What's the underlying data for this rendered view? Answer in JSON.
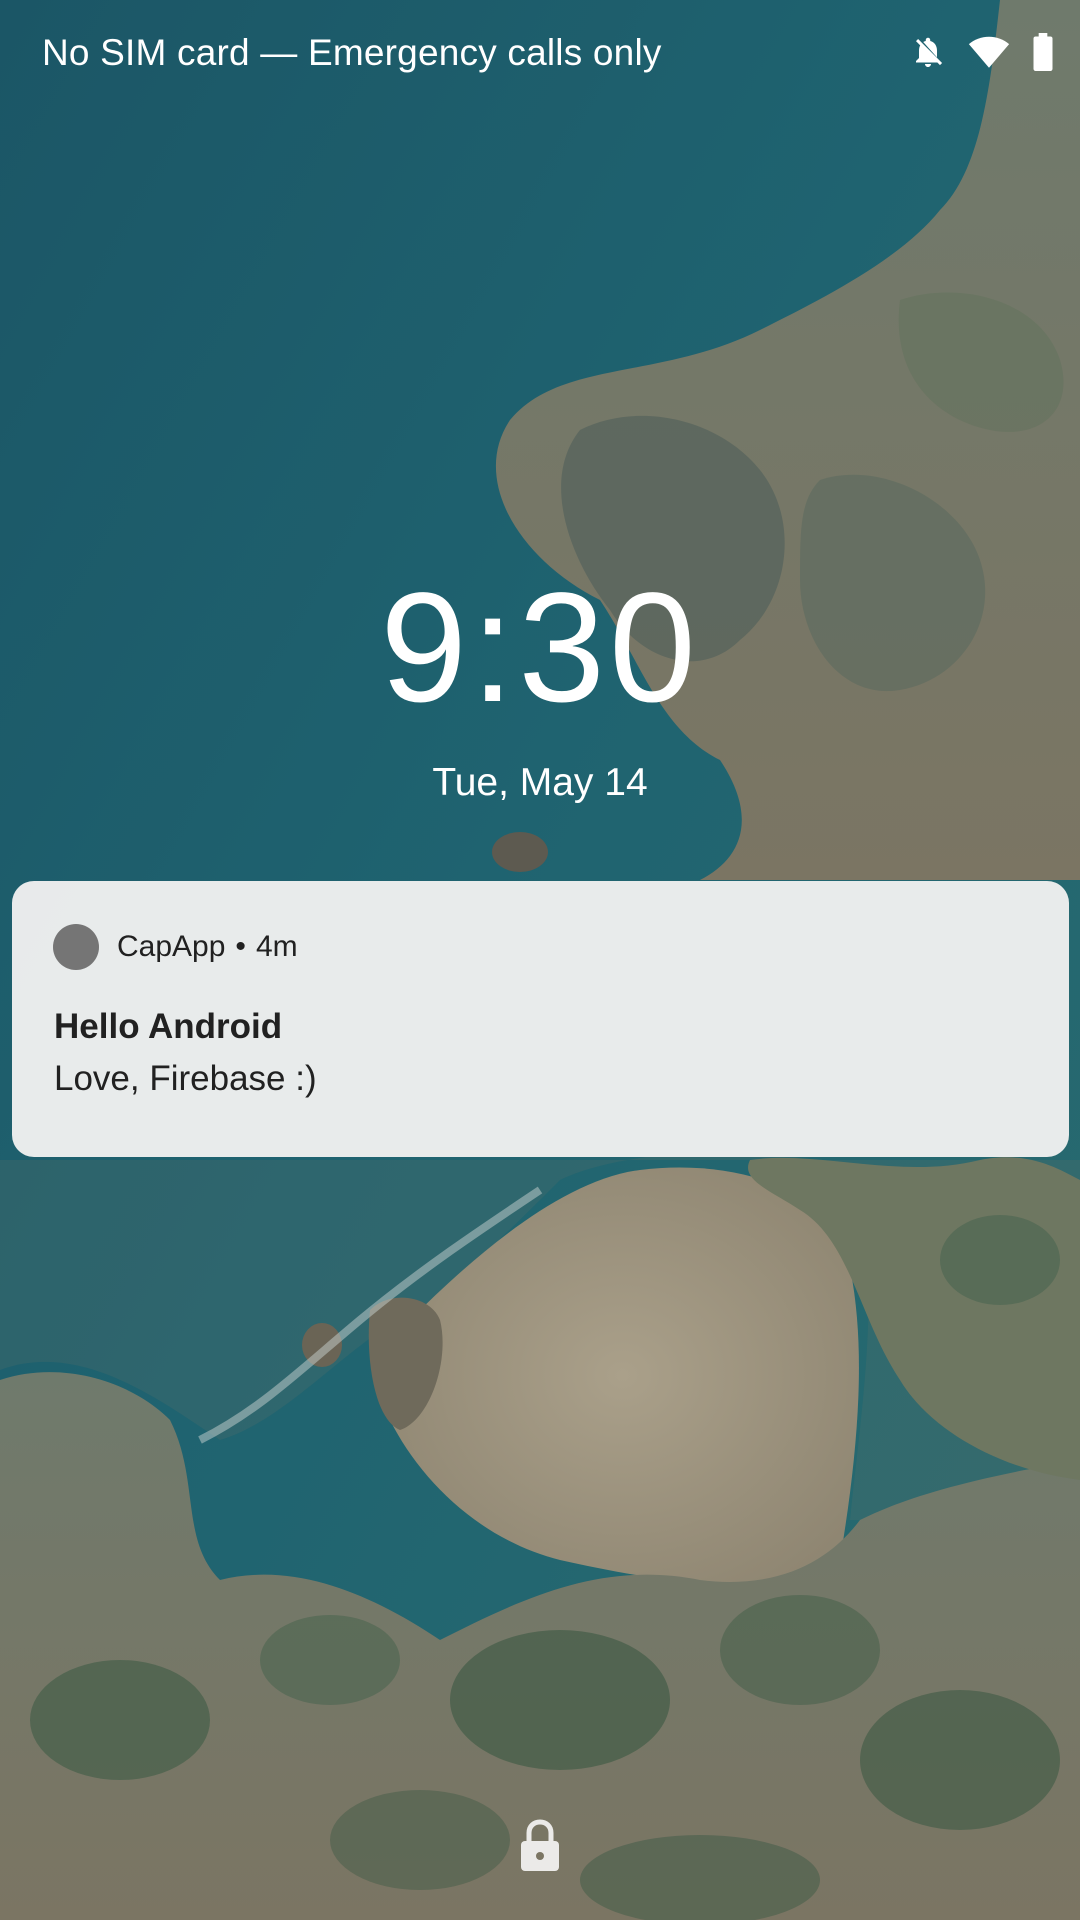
{
  "status_bar": {
    "carrier_text": "No SIM card — Emergency calls only",
    "icons": [
      "notifications-off-icon",
      "wifi-icon",
      "battery-icon"
    ]
  },
  "lockscreen": {
    "time": "9:30",
    "date": "Tue, May 14"
  },
  "notification": {
    "app_name": "CapApp",
    "separator": "•",
    "time_ago": "4m",
    "title": "Hello Android",
    "text": "Love, Firebase :)"
  },
  "bottom": {
    "icon": "lock-icon"
  },
  "colors": {
    "sea": "#1f5d6b",
    "land": "#8a7f68",
    "card": "#f0f0f0",
    "app_icon": "#757575"
  }
}
